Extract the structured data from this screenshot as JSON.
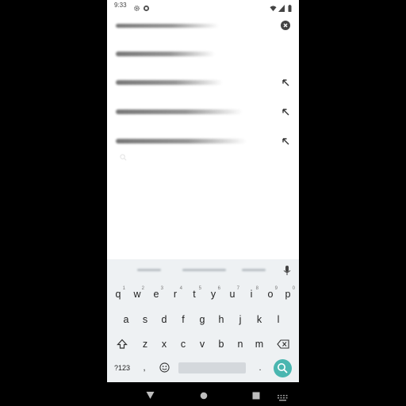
{
  "status_bar": {
    "time": "9:33",
    "icons": [
      "gear-icon",
      "circle-icon",
      "wifi-icon",
      "signal-icon",
      "battery-icon"
    ]
  },
  "search_field": {
    "clear_icon": "clear-icon"
  },
  "history_rows": [
    {
      "icon": "none"
    },
    {
      "icon": "arrow-up-left-icon"
    },
    {
      "icon": "arrow-up-left-icon"
    },
    {
      "icon": "arrow-up-left-icon"
    }
  ],
  "keyboard": {
    "row1": [
      {
        "key": "q",
        "hint": "1"
      },
      {
        "key": "w",
        "hint": "2"
      },
      {
        "key": "e",
        "hint": "3"
      },
      {
        "key": "r",
        "hint": "4"
      },
      {
        "key": "t",
        "hint": "5"
      },
      {
        "key": "y",
        "hint": "6"
      },
      {
        "key": "u",
        "hint": "7"
      },
      {
        "key": "i",
        "hint": "8"
      },
      {
        "key": "o",
        "hint": "9"
      },
      {
        "key": "p",
        "hint": "0"
      }
    ],
    "row2": [
      "a",
      "s",
      "d",
      "f",
      "g",
      "h",
      "j",
      "k",
      "l"
    ],
    "row3": [
      "z",
      "x",
      "c",
      "v",
      "b",
      "n",
      "m"
    ],
    "symbols_label": "?123",
    "comma": ",",
    "period": "."
  },
  "colors": {
    "accent": "#4ab6b0",
    "keyboard_bg": "#eef1f3"
  }
}
